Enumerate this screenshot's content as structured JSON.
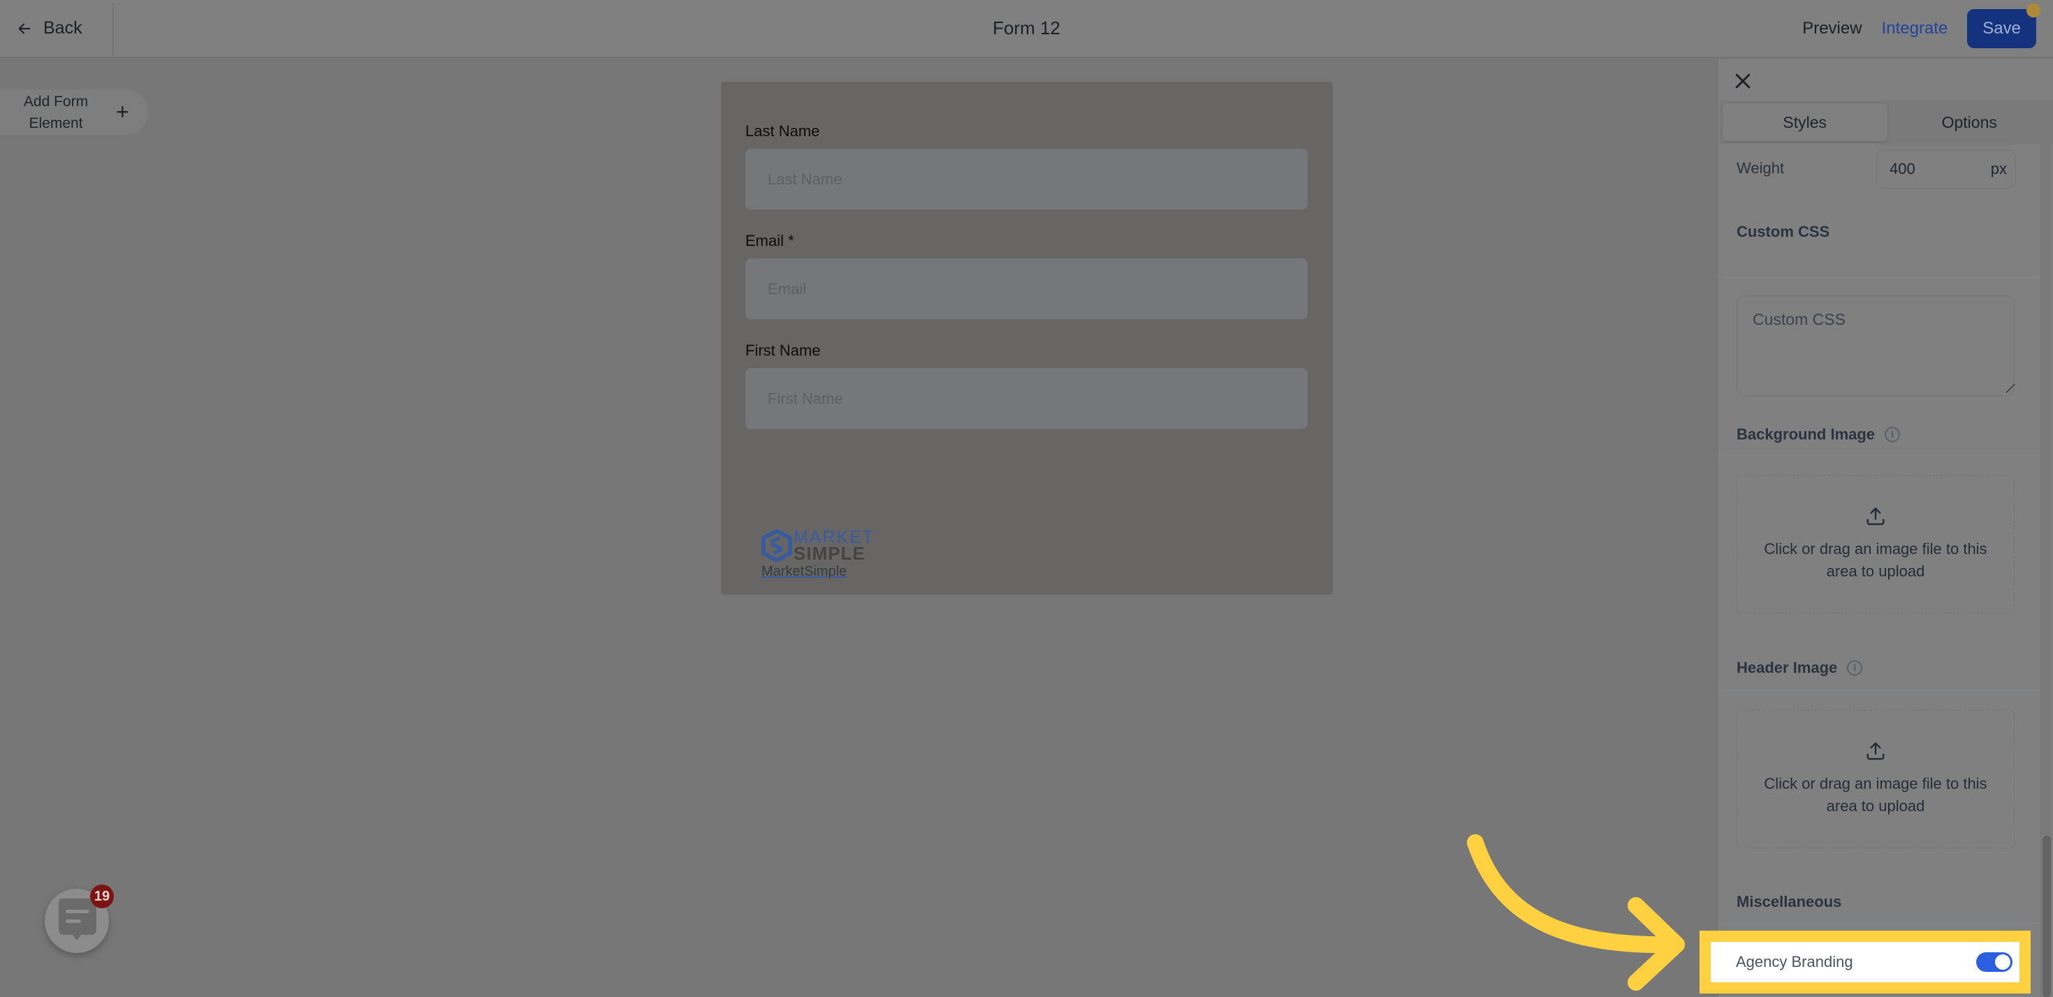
{
  "header": {
    "back_label": "Back",
    "title": "Form 12",
    "preview_label": "Preview",
    "integrate_label": "Integrate",
    "save_label": "Save"
  },
  "canvas": {
    "add_element_label": "Add Form Element",
    "add_icon": "plus-icon"
  },
  "form": {
    "fields": [
      {
        "label": "Last Name",
        "placeholder": "Last Name"
      },
      {
        "label": "Email *",
        "placeholder": "Email"
      },
      {
        "label": "First Name",
        "placeholder": "First Name"
      }
    ],
    "logo_line1": "MARKET",
    "logo_line2": "SIMPLE",
    "branding_link": "MarketSimple"
  },
  "panel": {
    "tabs": [
      {
        "label": "Styles",
        "active": true
      },
      {
        "label": "Options",
        "active": false
      }
    ],
    "weight": {
      "label": "Weight",
      "value": "400",
      "unit": "px"
    },
    "custom_css": {
      "title": "Custom CSS",
      "placeholder": "Custom CSS"
    },
    "background_image": {
      "title": "Background Image",
      "upload_text": "Click or drag an image file to this area to upload"
    },
    "header_image": {
      "title": "Header Image",
      "upload_text": "Click or drag an image file to this area to upload"
    },
    "miscellaneous": {
      "title": "Miscellaneous"
    },
    "agency_branding": {
      "label": "Agency Branding",
      "enabled": true
    }
  },
  "chat_widget": {
    "badge_count": "19"
  },
  "colors": {
    "accent_blue": "#2c5ee0",
    "save_button": "#14327e",
    "annotation_yellow": "#ffd040",
    "badge_red": "#7d1414"
  }
}
